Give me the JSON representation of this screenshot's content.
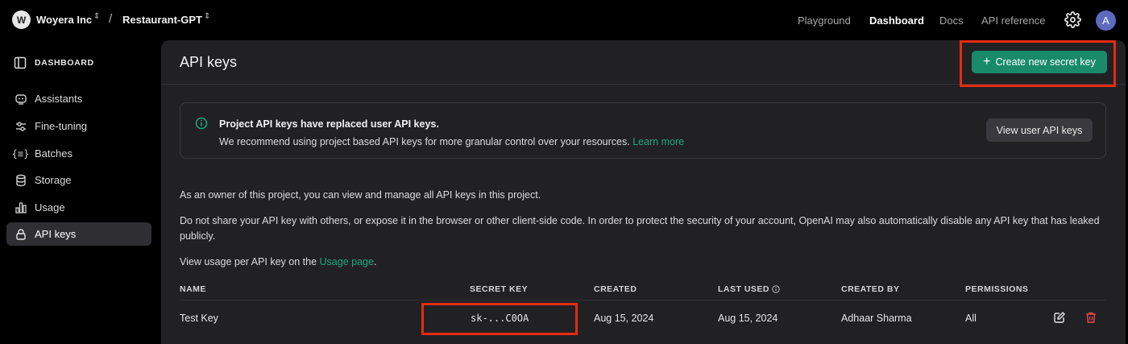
{
  "topbar": {
    "org_initial": "W",
    "org_name": "Woyera Inc",
    "separator": "/",
    "project_name": "Restaurant-GPT",
    "nav": [
      "Playground",
      "Dashboard",
      "Docs",
      "API reference"
    ],
    "active_nav": "Dashboard",
    "user_initial": "A"
  },
  "sidebar": {
    "header": "DASHBOARD",
    "items": [
      {
        "label": "Assistants",
        "icon": "assistant-icon"
      },
      {
        "label": "Fine-tuning",
        "icon": "sliders-icon"
      },
      {
        "label": "Batches",
        "icon": "braces-icon"
      },
      {
        "label": "Storage",
        "icon": "database-icon"
      },
      {
        "label": "Usage",
        "icon": "bar-chart-icon"
      },
      {
        "label": "API keys",
        "icon": "lock-icon"
      }
    ],
    "active_item": "API keys"
  },
  "main": {
    "title": "API keys",
    "create_button": "Create new secret key",
    "notice": {
      "title": "Project API keys have replaced user API keys.",
      "text": "We recommend using project based API keys for more granular control over your resources.",
      "link": "Learn more",
      "button": "View user API keys"
    },
    "para1": "As an owner of this project, you can view and manage all API keys in this project.",
    "para2": "Do not share your API key with others, or expose it in the browser or other client-side code. In order to protect the security of your account, OpenAI may also automatically disable any API key that has leaked publicly.",
    "para3_prefix": "View usage per API key on the",
    "para3_link": "Usage page",
    "para3_suffix": ".",
    "table": {
      "headers": [
        "NAME",
        "SECRET KEY",
        "CREATED",
        "LAST USED",
        "CREATED BY",
        "PERMISSIONS"
      ],
      "rows": [
        {
          "name": "Test Key",
          "secret": "sk-...C0OA",
          "created": "Aug 15, 2024",
          "last_used": "Aug 15, 2024",
          "created_by": "Adhaar Sharma",
          "permissions": "All"
        }
      ]
    }
  },
  "colors": {
    "accent_green": "#198a6a",
    "link_green": "#21a87d",
    "highlight_red": "#e52b12",
    "delete_red": "#e5484d"
  }
}
